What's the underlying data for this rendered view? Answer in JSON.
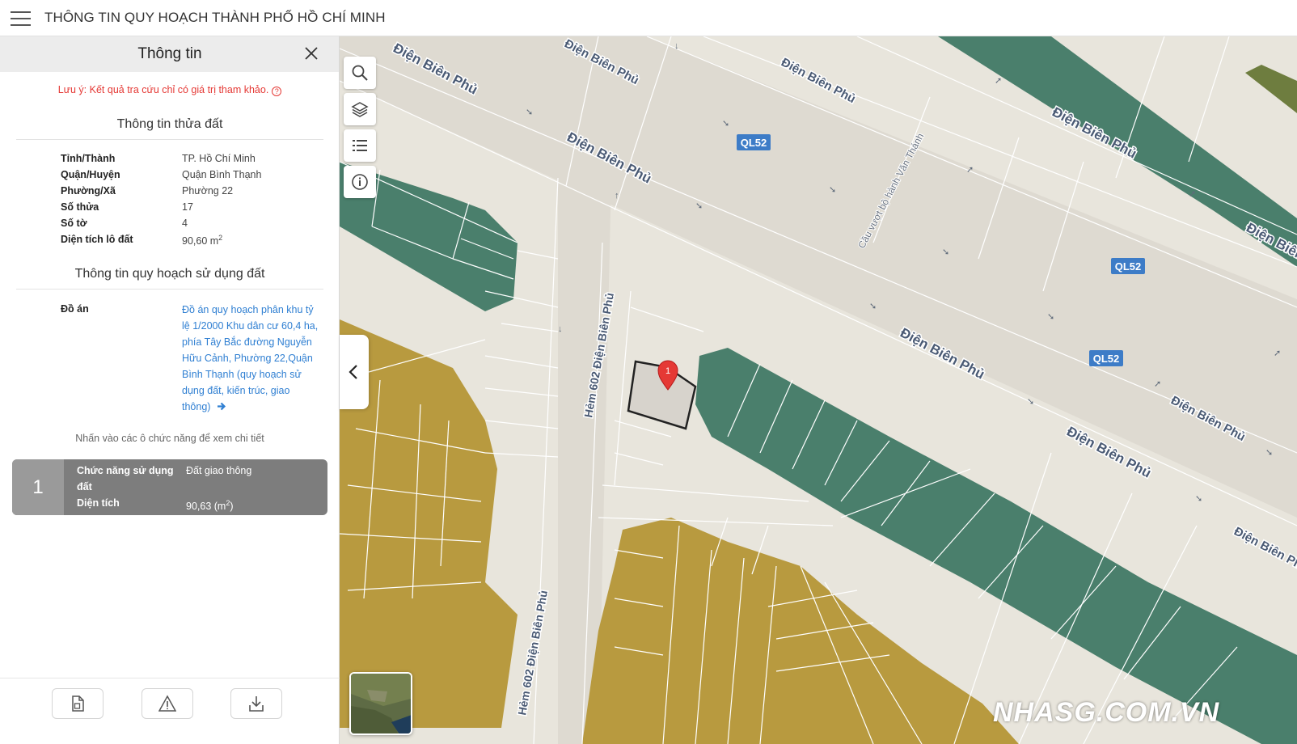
{
  "app": {
    "title": "THÔNG TIN QUY HOẠCH THÀNH PHỐ HỒ CHÍ MINH"
  },
  "panel": {
    "title": "Thông tin",
    "note": "Lưu ý: Kết quả tra cứu chỉ có giá trị tham khảo.",
    "parcel": {
      "title": "Thông tin thửa đất",
      "rows": [
        {
          "label": "Tỉnh/Thành",
          "value": "TP. Hồ Chí Minh"
        },
        {
          "label": "Quận/Huyện",
          "value": "Quận Bình Thạnh"
        },
        {
          "label": "Phường/Xã",
          "value": "Phường 22"
        },
        {
          "label": "Số thửa",
          "value": "17"
        },
        {
          "label": "Số tờ",
          "value": "4"
        },
        {
          "label": "Diện tích lô đất",
          "value": "90,60 m",
          "sup": "2"
        }
      ]
    },
    "planning": {
      "title": "Thông tin quy hoạch sử dụng đất",
      "plan_label": "Đồ án",
      "plan_text": "Đồ án quy hoạch phân khu tỷ lệ 1/2000 Khu dân cư 60,4 ha, phía Tây Bắc đường Nguyễn Hữu Cảnh, Phường 22,Quận Bình Thạnh (quy hoạch sử dụng đất, kiến trúc, giao thông)"
    },
    "hint": "Nhấn vào các ô chức năng để xem chi tiết",
    "function_card": {
      "number": "1",
      "function_label": "Chức năng sử dụng đất",
      "function_value": "Đất giao thông",
      "area_label": "Diện tích",
      "area_value": "90,63 (m",
      "area_sup": "2",
      "area_close": ")"
    }
  },
  "map": {
    "road_labels": {
      "dbp": "Điện Biên Phủ",
      "ql52": "QL52",
      "ham602": "Hẻm 602 Điện Biên Phủ",
      "bridge": "Cầu vượt bộ hành Văn Thánh"
    },
    "marker_label": "1",
    "watermark": "NHASG.COM.VN"
  },
  "colors": {
    "map_background": "#e8e5dc",
    "residential": "#b89a3f",
    "green_space": "#4a7f6c",
    "traffic_land": "#d7d3cc",
    "road_shield": "#3d7cc7",
    "marker": "#e53935",
    "note_text": "#e53935",
    "link": "#2f7fd2",
    "card_background": "#7d7d7d"
  }
}
